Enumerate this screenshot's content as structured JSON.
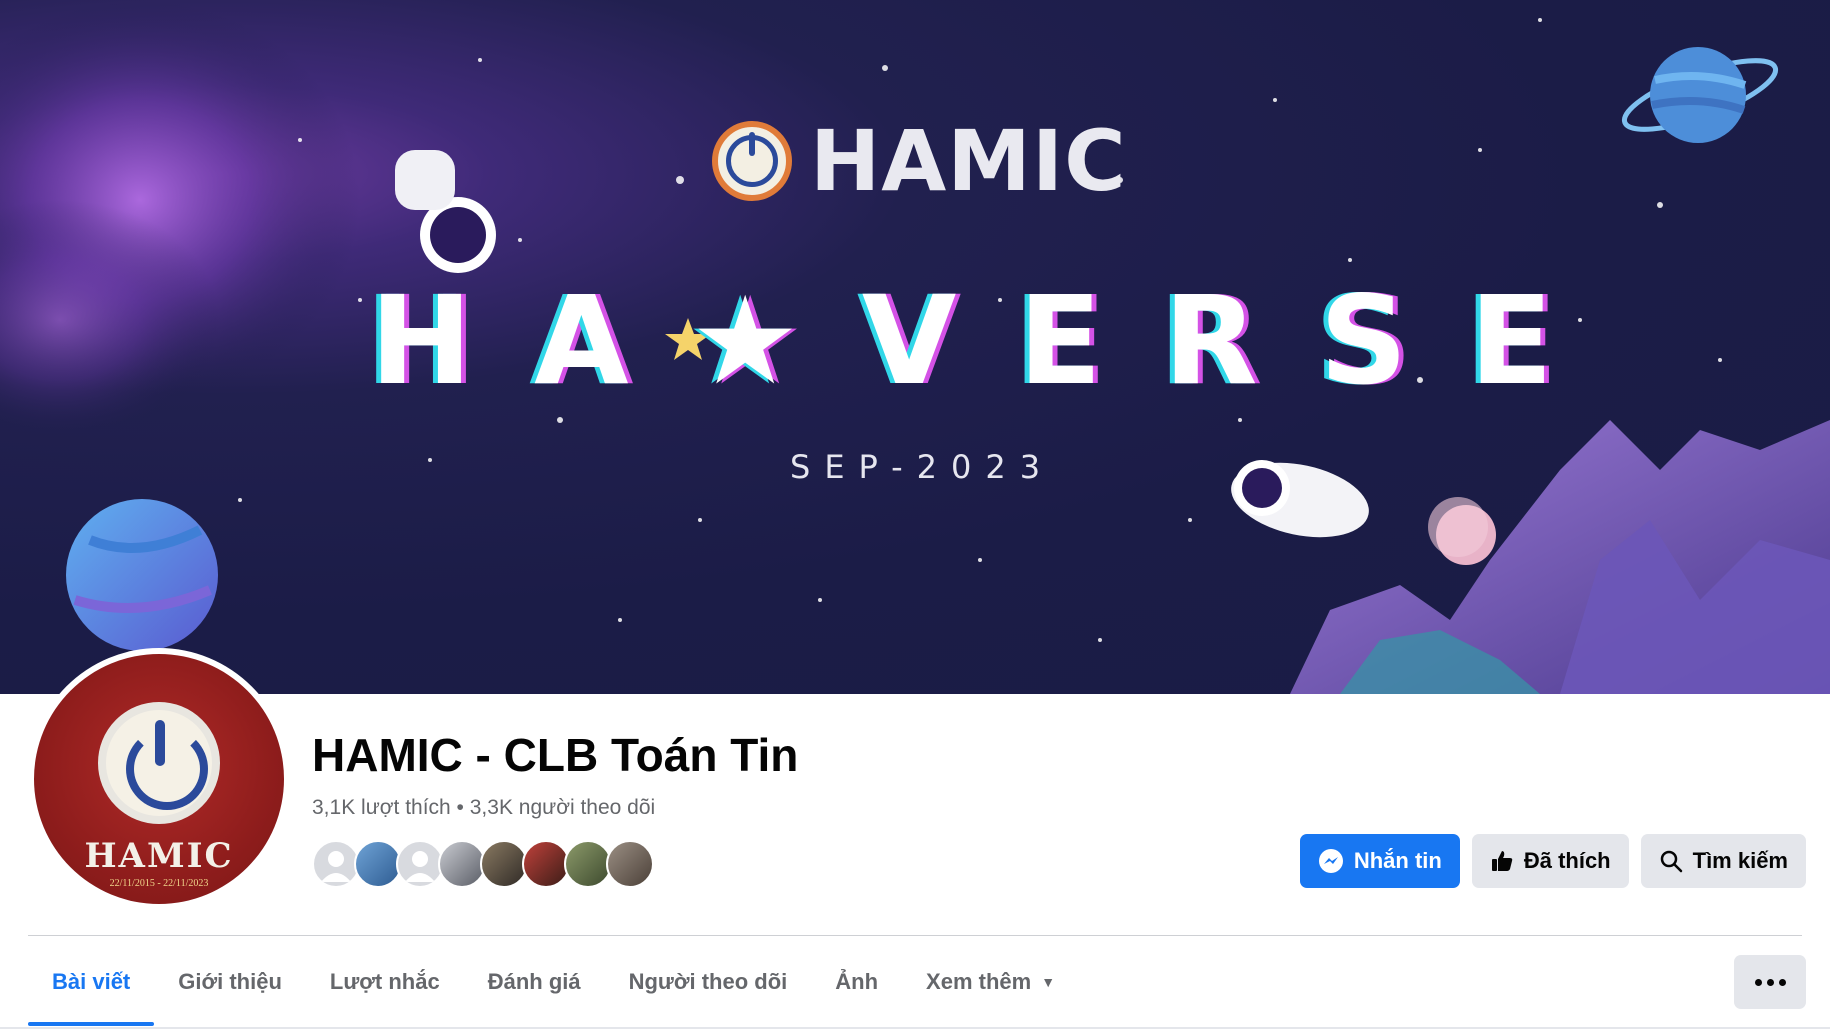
{
  "cover": {
    "brand": "HAMIC",
    "headline": "HA★VERSE",
    "subline": "SEP-2023"
  },
  "avatar": {
    "text": "HAMIC",
    "dates": "22/11/2015 - 22/11/2023"
  },
  "page": {
    "title": "HAMIC - CLB Toán Tin",
    "stats": "3,1K lượt thích • 3,3K người theo dõi"
  },
  "actions": {
    "message": "Nhắn tin",
    "liked": "Đã thích",
    "search": "Tìm kiếm"
  },
  "tabs": [
    {
      "label": "Bài viết",
      "active": true
    },
    {
      "label": "Giới thiệu"
    },
    {
      "label": "Lượt nhắc"
    },
    {
      "label": "Đánh giá"
    },
    {
      "label": "Người theo dõi"
    },
    {
      "label": "Ảnh"
    },
    {
      "label": "Xem thêm"
    }
  ],
  "colors": {
    "accent": "#1877f2",
    "button_bg": "#e4e6eb",
    "muted_text": "#65676b"
  }
}
